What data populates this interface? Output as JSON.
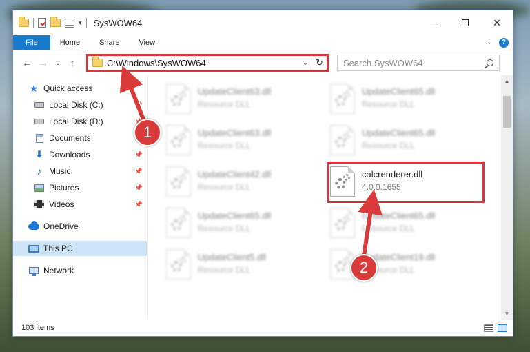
{
  "window": {
    "title": "SysWOW64",
    "controls": {
      "minimize": "—",
      "maximize": "☐",
      "close": "✕"
    }
  },
  "ribbon": {
    "tabs": [
      "File",
      "Home",
      "Share",
      "View"
    ]
  },
  "navigation": {
    "back": "←",
    "forward": "→",
    "up": "↑",
    "address_path": "C:\\Windows\\SysWOW64",
    "search_placeholder": "Search SysWOW64"
  },
  "sidebar": {
    "items": [
      {
        "label": "Quick access",
        "icon": "quick-access-star-icon"
      },
      {
        "label": "Local Disk (C:)",
        "icon": "drive-icon"
      },
      {
        "label": "Local Disk (D:)",
        "icon": "drive-icon"
      },
      {
        "label": "Documents",
        "icon": "documents-icon"
      },
      {
        "label": "Downloads",
        "icon": "downloads-icon"
      },
      {
        "label": "Music",
        "icon": "music-icon"
      },
      {
        "label": "Pictures",
        "icon": "pictures-icon"
      },
      {
        "label": "Videos",
        "icon": "videos-icon"
      },
      {
        "label": "OneDrive",
        "icon": "onedrive-icon"
      },
      {
        "label": "This PC",
        "icon": "this-pc-icon"
      },
      {
        "label": "Network",
        "icon": "network-icon"
      }
    ]
  },
  "files": [
    {
      "name": "UpdateClient63.dll",
      "type": "Resource DLL"
    },
    {
      "name": "UpdateClient65.dll",
      "type": "Resource DLL"
    },
    {
      "name": "UpdateClient63.dll",
      "type": "Resource DLL"
    },
    {
      "name": "UpdateClient65.dll",
      "type": "Resource DLL"
    },
    {
      "name": "UpdateClient42.dll",
      "type": "Resource DLL"
    },
    {
      "name": "calcrenderer.dll",
      "type": "4.0.0.1655"
    },
    {
      "name": "UpdateClient65.dll",
      "type": "Resource DLL"
    },
    {
      "name": "UpdateClient65.dll",
      "type": "Resource DLL"
    },
    {
      "name": "UpdateClient5.dll",
      "type": "Resource DLL"
    },
    {
      "name": "UpdateClient19.dll",
      "type": "Resource DLL"
    }
  ],
  "status": {
    "item_count": "103 items"
  },
  "callouts": {
    "step1": "1",
    "step2": "2"
  },
  "colors": {
    "accent": "#1979ca",
    "highlight": "#d9353b",
    "selected": "#cde4f7"
  }
}
